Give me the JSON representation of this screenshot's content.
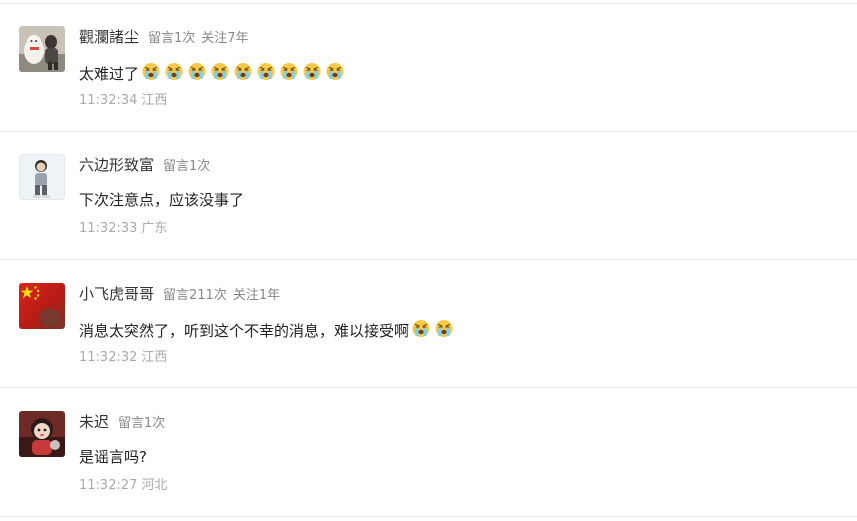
{
  "comments": [
    {
      "nickname": "觀瀾諸尘",
      "comment_count": "留言1次",
      "follow": "关注7年",
      "text": "太难过了",
      "emoji_count": 9,
      "emoji_name": "crying-face-icon",
      "time": "11:32:34",
      "location": "江西"
    },
    {
      "nickname": "六边形致富",
      "comment_count": "留言1次",
      "follow": "",
      "text": "下次注意点，应该没事了",
      "emoji_count": 0,
      "emoji_name": "",
      "time": "11:32:33",
      "location": "广东"
    },
    {
      "nickname": "小飞虎哥哥",
      "comment_count": "留言211次",
      "follow": "关注1年",
      "text": "消息太突然了，听到这个不幸的消息，难以接受啊",
      "emoji_count": 2,
      "emoji_name": "crying-face-icon",
      "time": "11:32:32",
      "location": "江西"
    },
    {
      "nickname": "未迟",
      "comment_count": "留言1次",
      "follow": "",
      "text": "是谣言吗?",
      "emoji_count": 0,
      "emoji_name": "",
      "time": "11:32:27",
      "location": "河北"
    }
  ],
  "colors": {
    "nickname": "#333333",
    "meta": "#888888",
    "text": "#222222",
    "footer": "#aaaaaa",
    "divider": "#e6e6e6",
    "emoji_face": "#f7c948",
    "emoji_tears": "#7fd1e8"
  }
}
